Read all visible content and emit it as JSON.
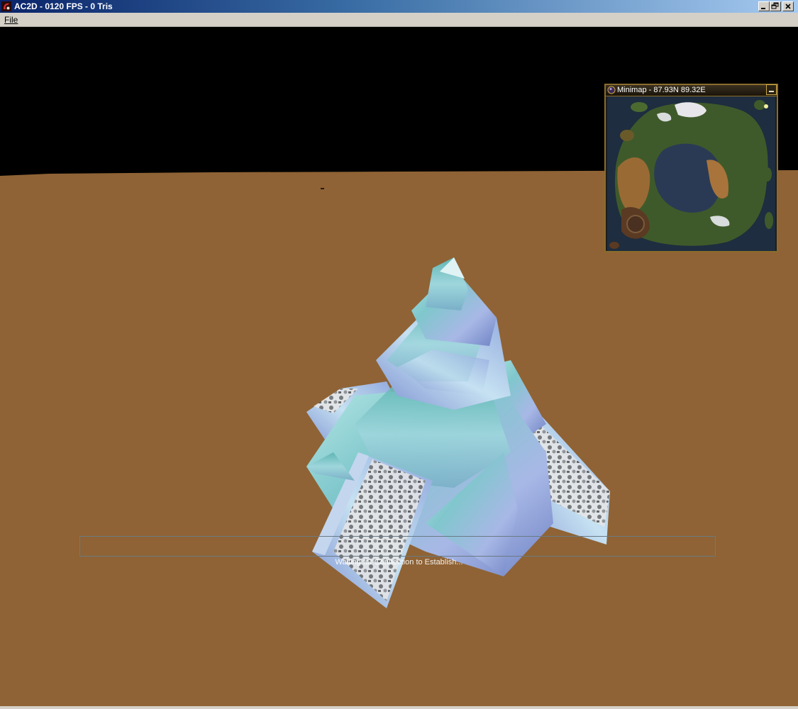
{
  "window": {
    "title": "AC2D - 0120 FPS - 0 Tris",
    "icon": "app-icon",
    "controls": [
      "minimize-icon",
      "restore-icon",
      "close-icon"
    ]
  },
  "menu": {
    "file": "File"
  },
  "minimap": {
    "title": "Minimap - 87.93N 89.32E",
    "icon": "orb-icon",
    "minimize_icon": "minimize-icon"
  },
  "status": {
    "message": "Waiting for Connection to Establish..."
  },
  "colors": {
    "sky": "#000000",
    "ground": "#8f6335",
    "title_bar_start": "#0a246a",
    "title_bar_end": "#a6caf0",
    "minimap_border": "#8a6d2c",
    "crystal": "#9ed6dc"
  }
}
